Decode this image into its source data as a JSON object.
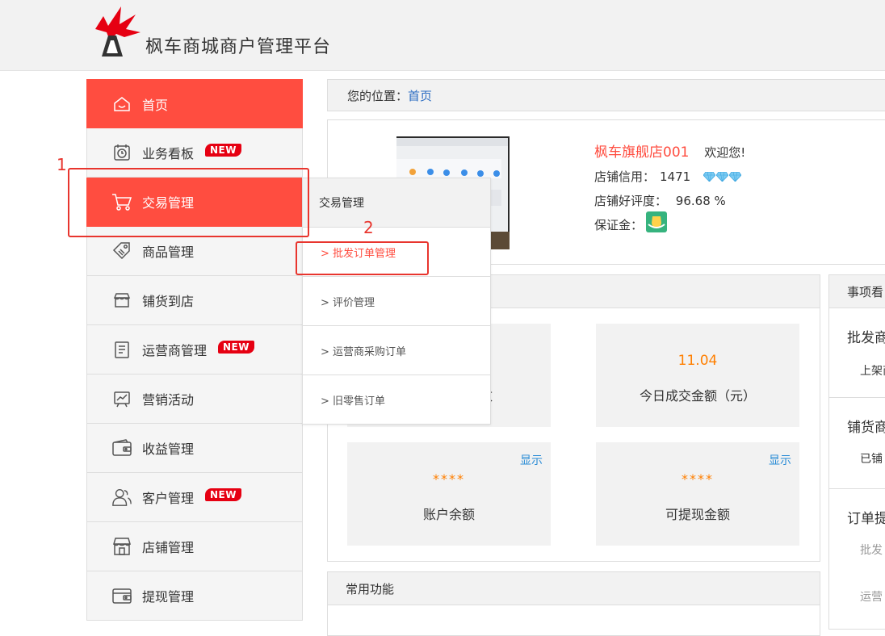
{
  "header": {
    "title": "枫车商城商户管理平台"
  },
  "sidebar": {
    "items": [
      {
        "label": "首页",
        "icon": "home-icon",
        "active": true,
        "badge": ""
      },
      {
        "label": "业务看板",
        "icon": "dashboard-icon",
        "active": false,
        "badge": "NEW"
      },
      {
        "label": "交易管理",
        "icon": "cart-icon",
        "active": true,
        "badge": ""
      },
      {
        "label": "商品管理",
        "icon": "tag-icon",
        "active": false,
        "badge": ""
      },
      {
        "label": "铺货到店",
        "icon": "store-awning-icon",
        "active": false,
        "badge": ""
      },
      {
        "label": "运营商管理",
        "icon": "document-list-icon",
        "active": false,
        "badge": "NEW"
      },
      {
        "label": "营销活动",
        "icon": "chart-board-icon",
        "active": false,
        "badge": ""
      },
      {
        "label": "收益管理",
        "icon": "wallet-icon",
        "active": false,
        "badge": ""
      },
      {
        "label": "客户管理",
        "icon": "users-icon",
        "active": false,
        "badge": "NEW"
      },
      {
        "label": "店铺管理",
        "icon": "shop-icon",
        "active": false,
        "badge": ""
      },
      {
        "label": "提现管理",
        "icon": "withdraw-icon",
        "active": false,
        "badge": ""
      }
    ]
  },
  "flyout": {
    "title": "交易管理",
    "items": [
      "> 批发订单管理",
      "> 评价管理",
      "> 运营商采购订单",
      "> 旧零售订单"
    ]
  },
  "annotations": {
    "one": "1",
    "two": "2"
  },
  "breadcrumb": {
    "prefix": "您的位置：",
    "current": "首页"
  },
  "store": {
    "name": "枫车旗舰店001",
    "welcome": "欢迎您!",
    "credit_label": "店铺信用：",
    "credit_value": "1471",
    "rating_label": "店铺好评度：",
    "rating_value": "96.68 %",
    "deposit_label": "保证金："
  },
  "stats": {
    "t1_label": "数",
    "t2_value": "11.04",
    "t2_label": "今日成交金额（元）",
    "t3_value": "****",
    "t3_label": "账户余额",
    "t3_toggle": "显示",
    "t4_value": "****",
    "t4_label": "可提现金额",
    "t4_toggle": "显示"
  },
  "common": {
    "title": "常用功能"
  },
  "right_panel": {
    "title": "事项看",
    "s1_title": "批发商",
    "s1_sub": "上架商",
    "s2_title": "铺货商",
    "s2_sub": "已铺",
    "s3_title": "订单提",
    "s3_sub1": "批发",
    "s3_sub2": "运营"
  },
  "colors": {
    "accent": "#ff4d40",
    "link": "#2a6cc2",
    "amount": "#ff7f00",
    "badge": "#e60012"
  }
}
